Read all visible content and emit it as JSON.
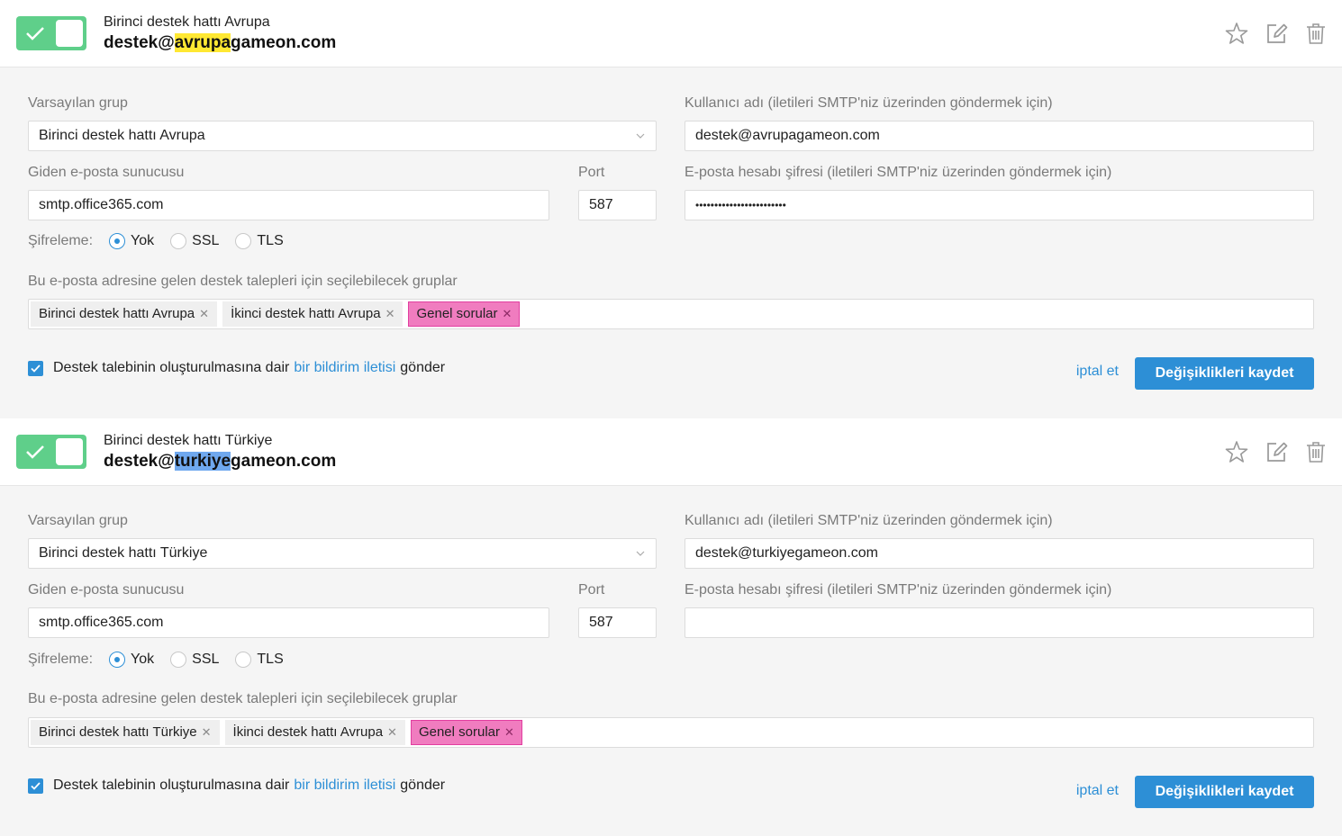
{
  "accounts": [
    {
      "header": {
        "name": "Birinci destek hattı Avrupa",
        "email_prefix": "destek@",
        "email_highlight": "avrupa",
        "email_suffix": "gameon.com",
        "highlight_color": "#ffe833"
      },
      "labels": {
        "default_group": "Varsayılan grup",
        "username": "Kullanıcı adı (iletileri SMTP'niz üzerinden göndermek için)",
        "smtp_server": "Giden e-posta sunucusu",
        "port": "Port",
        "password": "E-posta hesabı şifresi (iletileri SMTP'niz üzerinden göndermek için)",
        "encryption": "Şifreleme:",
        "groups": "Bu e-posta adresine gelen destek talepleri için seçilebilecek gruplar"
      },
      "default_group": "Birinci destek hattı Avrupa",
      "username": "destek@avrupagameon.com",
      "smtp_server": "smtp.office365.com",
      "port": "587",
      "password": "••••••••••••••••••••••••",
      "encryption_options": [
        "Yok",
        "SSL",
        "TLS"
      ],
      "encryption_selected": "Yok",
      "groups": [
        "Birinci destek hattı Avrupa",
        "İkinci destek hattı Avrupa",
        "Genel sorular"
      ],
      "notify": {
        "before": "Destek talebinin oluşturulmasına dair",
        "link": "bir bildirim iletisi",
        "after": "gönder",
        "checked": true
      },
      "cancel_label": "iptal et",
      "save_label": "Değişiklikleri kaydet"
    },
    {
      "header": {
        "name": "Birinci destek hattı Türkiye",
        "email_prefix": "destek@",
        "email_highlight": "turkiye",
        "email_suffix": "gameon.com",
        "highlight_color": "#6fa8ee"
      },
      "labels": {
        "default_group": "Varsayılan grup",
        "username": "Kullanıcı adı (iletileri SMTP'niz üzerinden göndermek için)",
        "smtp_server": "Giden e-posta sunucusu",
        "port": "Port",
        "password": "E-posta hesabı şifresi (iletileri SMTP'niz üzerinden göndermek için)",
        "encryption": "Şifreleme:",
        "groups": "Bu e-posta adresine gelen destek talepleri için seçilebilecek gruplar"
      },
      "default_group": "Birinci destek hattı Türkiye",
      "username": "destek@turkiyegameon.com",
      "smtp_server": "smtp.office365.com",
      "port": "587",
      "password": "",
      "encryption_options": [
        "Yok",
        "SSL",
        "TLS"
      ],
      "encryption_selected": "Yok",
      "groups": [
        "Birinci destek hattı Türkiye",
        "İkinci destek hattı Avrupa",
        "Genel sorular"
      ],
      "notify": {
        "before": "Destek talebinin oluşturulmasına dair",
        "link": "bir bildirim iletisi",
        "after": "gönder",
        "checked": true
      },
      "cancel_label": "iptal et",
      "save_label": "Değişiklikleri kaydet"
    }
  ],
  "colors": {
    "accent": "#2d8fd6",
    "toggle_on": "#5fcf8a",
    "tag_highlight": "#f07cbf"
  },
  "icons": [
    "check-icon",
    "star-icon",
    "edit-icon",
    "trash-icon",
    "chevron-down-icon",
    "close-icon"
  ]
}
